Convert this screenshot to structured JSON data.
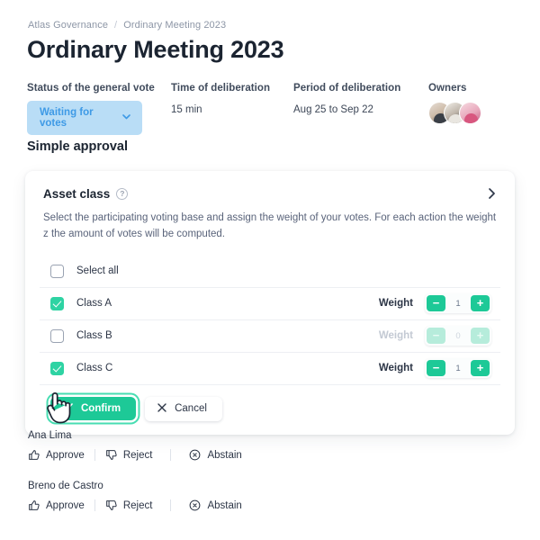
{
  "breadcrumb": {
    "root": "Atlas Governance",
    "separator": "/",
    "current": "Ordinary Meeting 2023"
  },
  "page_title": "Ordinary Meeting 2023",
  "meta": {
    "status": {
      "label": "Status of the general vote",
      "value": "Waiting for votes",
      "chevron": "⌄",
      "pill_bg": "#b9ddf6",
      "pill_fg": "#3e9ae6"
    },
    "time": {
      "label": "Time of deliberation",
      "value": "15 min"
    },
    "period": {
      "label": "Period of deliberation",
      "value": "Aug 25 to Sep 22"
    },
    "owners": {
      "label": "Owners",
      "count": 3
    }
  },
  "section_title": "Simple approval",
  "card": {
    "title": "Asset class",
    "help_icon": "?",
    "expand_icon": "›",
    "description": "Select the participating voting base and assign the weight of your votes. For each action the weight z the amount of votes will be computed.",
    "select_all": {
      "label": "Select all",
      "checked": false
    },
    "weight_label": "Weight",
    "minus": "−",
    "plus": "+",
    "classes": [
      {
        "label": "Class A",
        "checked": true,
        "weight": "1",
        "disabled": false
      },
      {
        "label": "Class B",
        "checked": false,
        "weight": "0",
        "disabled": true
      },
      {
        "label": "Class C",
        "checked": true,
        "weight": "1",
        "disabled": false
      }
    ],
    "confirm": {
      "label": "Confirm",
      "icon": "✓",
      "color": "#1dc997",
      "focused": true
    },
    "cancel": {
      "label": "Cancel",
      "icon": "✕"
    }
  },
  "voters": [
    {
      "name": "Ana Lima",
      "approve": "Approve",
      "reject": "Reject",
      "abstain": "Abstain"
    },
    {
      "name": "Breno de Castro",
      "approve": "Approve",
      "reject": "Reject",
      "abstain": "Abstain"
    }
  ]
}
